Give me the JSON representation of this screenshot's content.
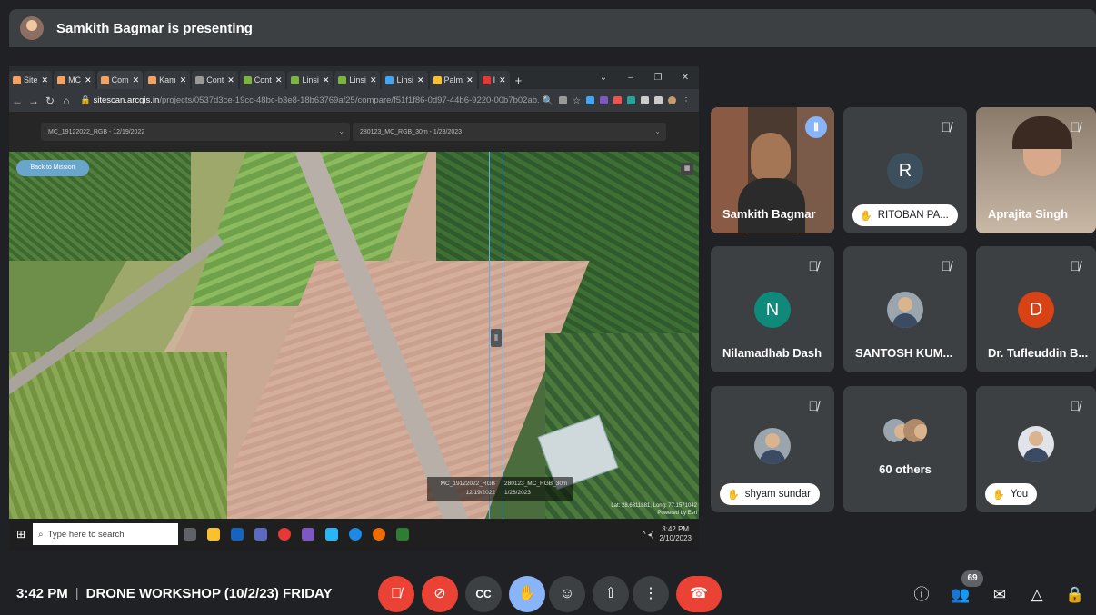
{
  "topbar": {
    "presenting": "Samkith Bagmar is presenting"
  },
  "browser": {
    "tabs": [
      "Site",
      "MC",
      "Com",
      "Kam",
      "Cont",
      "Cont",
      "Linsi",
      "Linsi",
      "Linsi",
      "Palm",
      "I"
    ],
    "url_host": "sitescan.arcgis.in",
    "url_path": "/projects/0537d3ce-19cc-48bc-b3e8-18b63769af25/compare/f51f1f86-0d97-44b6-9220-00b7b02ab...",
    "left_dropdown": "MC_19122022_RGB - 12/19/2022",
    "right_dropdown": "280123_MC_RGB_30m - 1/28/2023",
    "back_button": "Back to Mission",
    "left_label_a": "MC_19122022_RGB",
    "left_label_b": "12/19/2022",
    "right_label_a": "280123_MC_RGB_30m",
    "right_label_b": "1/28/2023",
    "coords": "Lat: 28.6311881, Long: 77.1571042",
    "powered": "Powered by Esri"
  },
  "taskbar": {
    "search_placeholder": "Type here to search",
    "time": "3:42 PM",
    "date": "2/10/2023"
  },
  "participants": [
    {
      "name": "Samkith Bagmar",
      "type": "video",
      "speaking": true
    },
    {
      "name": "RITOBAN PA...",
      "type": "letter",
      "letter": "R",
      "color": "#3c4f5c",
      "hand": true
    },
    {
      "name": "Aprajita Singh",
      "type": "video"
    },
    {
      "name": "Nilamadhab Dash",
      "type": "letter",
      "letter": "N",
      "color": "#0f8a7a"
    },
    {
      "name": "SANTOSH KUM...",
      "type": "photo"
    },
    {
      "name": "Dr. Tufleuddin B...",
      "type": "letter",
      "letter": "D",
      "color": "#d84315"
    },
    {
      "name": "shyam sundar",
      "type": "photo",
      "hand": true
    },
    {
      "name": "60 others",
      "type": "others"
    },
    {
      "name": "You",
      "type": "photo",
      "hand": true
    }
  ],
  "bottombar": {
    "time": "3:42 PM",
    "meeting_name": "DRONE WORKSHOP (10/2/23) FRIDAY",
    "participant_count": "69"
  },
  "colors": {
    "end_call": "#ea4335",
    "raise_hand_active": "#8ab4f8",
    "background": "#202124",
    "tile": "#3c4043"
  }
}
